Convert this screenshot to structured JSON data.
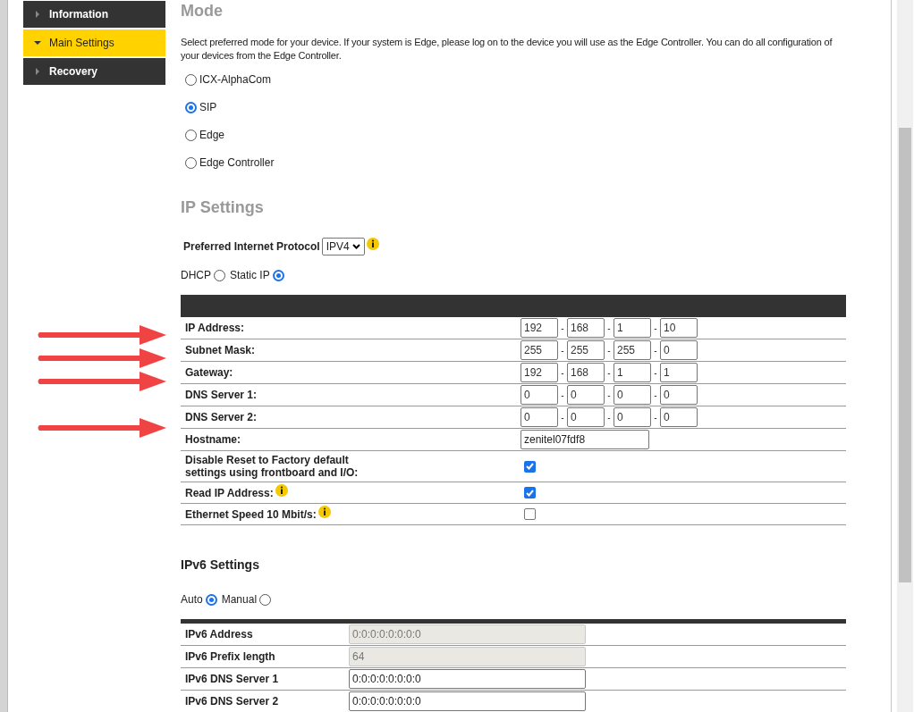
{
  "sidebar": {
    "items": [
      {
        "label": "Information",
        "selected": false,
        "expanded": false
      },
      {
        "label": "Main Settings",
        "selected": true,
        "expanded": true
      },
      {
        "label": "Recovery",
        "selected": false,
        "expanded": false
      }
    ]
  },
  "mode": {
    "title": "Mode",
    "description": "Select preferred mode for your device. If your system is Edge, please log on to the device you will use as the Edge Controller. You can do all configuration of your devices from the Edge Controller.",
    "options": [
      {
        "label": "ICX-AlphaCom",
        "selected": false
      },
      {
        "label": "SIP",
        "selected": true
      },
      {
        "label": "Edge",
        "selected": false
      },
      {
        "label": "Edge Controller",
        "selected": false
      }
    ]
  },
  "ip_settings": {
    "title": "IP Settings",
    "protocol_label": "Preferred Internet Protocol",
    "protocol_value": "IPV4",
    "addressing": [
      {
        "label": "DHCP",
        "selected": false
      },
      {
        "label": "Static IP",
        "selected": true
      }
    ],
    "rows": [
      {
        "kind": "octets",
        "label": "IP Address:",
        "highlighted": true,
        "octets": [
          "192",
          "168",
          "1",
          "10"
        ],
        "separators": [
          "-",
          "-",
          "-"
        ]
      },
      {
        "kind": "octets",
        "label": "Subnet Mask:",
        "highlighted": true,
        "octets": [
          "255",
          "255",
          "255",
          "0"
        ],
        "separators": [
          "-",
          "-",
          "-"
        ]
      },
      {
        "kind": "octets",
        "label": "Gateway:",
        "highlighted": true,
        "octets": [
          "192",
          "168",
          "1",
          "1"
        ],
        "separators": [
          "-",
          "-",
          "-"
        ]
      },
      {
        "kind": "octets",
        "label": "DNS Server 1:",
        "highlighted": false,
        "octets": [
          "0",
          "0",
          "0",
          "0"
        ],
        "separators": [
          "-",
          "-",
          "-"
        ]
      },
      {
        "kind": "octets",
        "label": "DNS Server 2:",
        "highlighted": true,
        "octets": [
          "0",
          "0",
          "0",
          "0"
        ],
        "separators": [
          "-",
          "-",
          "-"
        ]
      },
      {
        "kind": "text",
        "label": "Hostname:",
        "highlighted": false,
        "value": "zenitel07fdf8"
      },
      {
        "kind": "checkbox",
        "label": "Disable Reset to Factory default settings using frontboard and I/O:",
        "highlighted": false,
        "checked": true,
        "info": false
      },
      {
        "kind": "checkbox",
        "label": "Read IP Address:",
        "highlighted": false,
        "checked": true,
        "info": true
      },
      {
        "kind": "checkbox",
        "label": "Ethernet Speed 10 Mbit/s:",
        "highlighted": false,
        "checked": false,
        "info": true
      }
    ]
  },
  "ipv6_settings": {
    "title": "IPv6 Settings",
    "addressing": [
      {
        "label": "Auto",
        "selected": true
      },
      {
        "label": "Manual",
        "selected": false
      }
    ],
    "rows": [
      {
        "label": "IPv6 Address",
        "value": "0:0:0:0:0:0:0:0",
        "disabled": true
      },
      {
        "label": "IPv6 Prefix length",
        "value": "64",
        "disabled": true
      },
      {
        "label": "IPv6 DNS Server 1",
        "value": "0:0:0:0:0:0:0:0",
        "disabled": false
      },
      {
        "label": "IPv6 DNS Server 2",
        "value": "0:0:0:0:0:0:0:0",
        "disabled": false
      }
    ]
  }
}
